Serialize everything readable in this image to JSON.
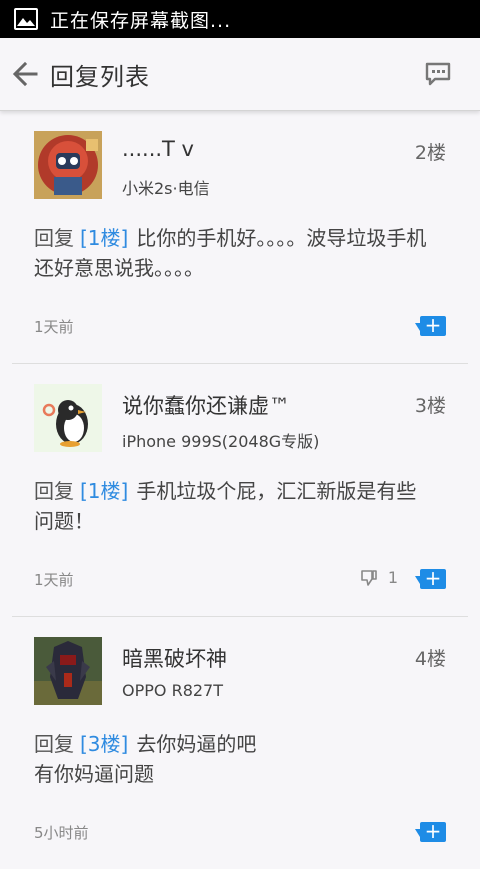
{
  "status_bar": {
    "text": "正在保存屏幕截图..."
  },
  "header": {
    "title": "回复列表"
  },
  "colors": {
    "accent": "#1e8ce6",
    "link": "#2f8be0"
  },
  "posts": [
    {
      "username": "......T v",
      "floor": "2楼",
      "device": "小米2s·电信",
      "reply_word": "回复",
      "reply_ref": "[1楼]",
      "text": "比你的手机好。。。。波导垃圾手机还好意思说我。。。。",
      "time": "1天前",
      "plus": "+"
    },
    {
      "username": "说你蠢你还谦虚™",
      "floor": "3楼",
      "device": "iPhone 999S(2048G专版)",
      "reply_word": "回复",
      "reply_ref": "[1楼]",
      "text": "手机垃圾个屁，汇汇新版是有些问题！",
      "time": "1天前",
      "dislike_count": "1",
      "plus": "+"
    },
    {
      "username": "暗黑破坏神",
      "floor": "4楼",
      "device": "OPPO R827T",
      "reply_word": "回复",
      "reply_ref": "[3楼]",
      "text": "去你妈逼的吧",
      "text_line2": "有你妈逼问题",
      "time": "5小时前",
      "plus": "+"
    }
  ],
  "icons": {
    "status": "image-icon",
    "back": "arrow-left-icon",
    "comment": "comment-icon",
    "dislike": "thumbs-down-icon"
  }
}
